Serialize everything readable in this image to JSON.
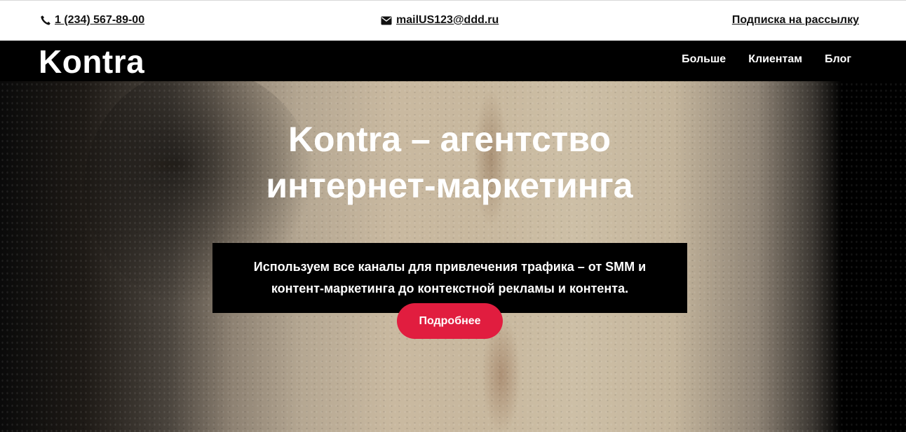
{
  "topbar": {
    "phone": "1 (234) 567-89-00",
    "email": "mailUS123@ddd.ru",
    "subscribe": "Подписка на рассылку",
    "phone_icon": "phone-icon",
    "email_icon": "envelope-icon"
  },
  "header": {
    "logo": "Kontra",
    "nav": [
      "Больше",
      "Клиентам",
      "Блог"
    ]
  },
  "hero": {
    "title_line1": "Kontra – агентство",
    "title_line2": "интернет-маркетинга",
    "description_line1": "Используем все каналы для привлечения трафика – от SMM и",
    "description_line2": "контент-маркетинга до контекстной рекламы и контента.",
    "button_label": "Подробнее"
  },
  "colors": {
    "accent": "#e11d3f",
    "navbar_bg": "#000000",
    "topbar_bg": "#ffffff"
  }
}
